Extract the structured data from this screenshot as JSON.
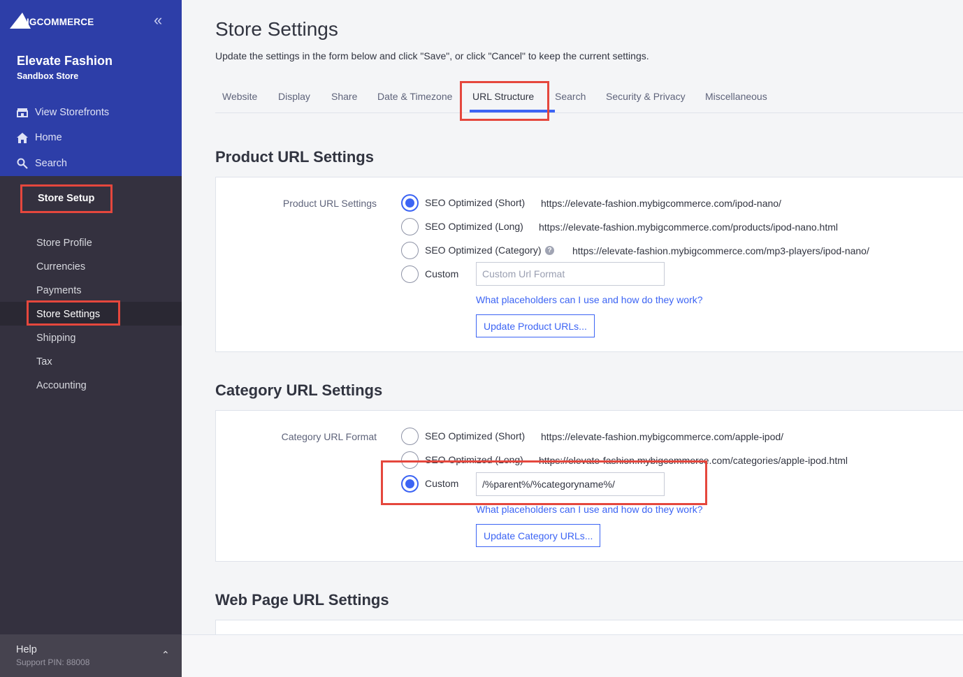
{
  "brand": {
    "logo_text": "BIGCOMMERCE",
    "collapse_icon": "double-chevron-left-icon"
  },
  "store": {
    "name": "Elevate Fashion",
    "subtitle": "Sandbox Store"
  },
  "nav": {
    "view_storefronts": "View Storefronts",
    "home": "Home",
    "search": "Search",
    "store_setup": "Store Setup"
  },
  "submenu": {
    "items": [
      "Store Profile",
      "Currencies",
      "Payments",
      "Store Settings",
      "Shipping",
      "Tax",
      "Accounting"
    ],
    "active": "Store Settings"
  },
  "help": {
    "title": "Help",
    "pin": "Support PIN: 88008"
  },
  "page": {
    "title": "Store Settings",
    "description": "Update the settings in the form below and click \"Save\", or click \"Cancel\" to keep the current settings."
  },
  "tabs": {
    "items": [
      "Website",
      "Display",
      "Share",
      "Date & Timezone",
      "URL Structure",
      "Search",
      "Security & Privacy",
      "Miscellaneous"
    ],
    "active": "URL Structure"
  },
  "product_url": {
    "section_title": "Product URL Settings",
    "field_label": "Product URL Settings",
    "options": [
      {
        "label": "SEO Optimized (Short)",
        "url": "https://elevate-fashion.mybigcommerce.com/ipod-nano/",
        "selected": true
      },
      {
        "label": "SEO Optimized (Long)",
        "url": "https://elevate-fashion.mybigcommerce.com/products/ipod-nano.html",
        "selected": false
      },
      {
        "label": "SEO Optimized (Category)",
        "url": "https://elevate-fashion.mybigcommerce.com/mp3-players/ipod-nano/",
        "selected": false
      },
      {
        "label": "Custom",
        "url": "",
        "selected": false
      }
    ],
    "custom_placeholder": "Custom Url Format",
    "custom_value": "",
    "help_link": "What placeholders can I use and how do they work?",
    "update_button": "Update Product URLs..."
  },
  "category_url": {
    "section_title": "Category URL Settings",
    "field_label": "Category URL Format",
    "options": [
      {
        "label": "SEO Optimized (Short)",
        "url": "https://elevate-fashion.mybigcommerce.com/apple-ipod/",
        "selected": false
      },
      {
        "label": "SEO Optimized (Long)",
        "url": "https://elevate-fashion.mybigcommerce.com/categories/apple-ipod.html",
        "selected": false
      },
      {
        "label": "Custom",
        "url": "",
        "selected": true
      }
    ],
    "custom_value": "/%parent%/%categoryname%/",
    "help_link": "What placeholders can I use and how do they work?",
    "update_button": "Update Category URLs..."
  },
  "web_page_url": {
    "section_title": "Web Page URL Settings"
  },
  "colors": {
    "sidebar_top": "#2d3ea8",
    "sidebar": "#34313f",
    "accent": "#3c64f4",
    "highlight": "#e5473d"
  }
}
